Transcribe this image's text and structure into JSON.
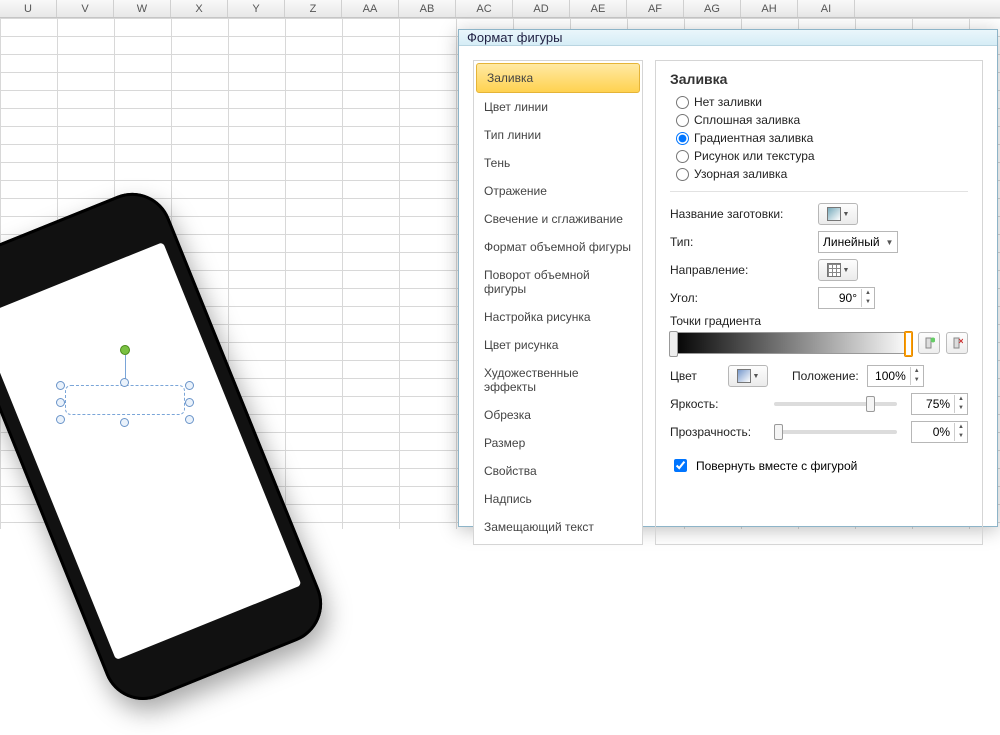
{
  "columns": [
    "U",
    "V",
    "W",
    "X",
    "Y",
    "Z",
    "AA",
    "AB",
    "AC",
    "AD",
    "AE",
    "AF",
    "AG",
    "AH",
    "AI"
  ],
  "dialog": {
    "title": "Формат фигуры",
    "nav": {
      "items": [
        "Заливка",
        "Цвет линии",
        "Тип линии",
        "Тень",
        "Отражение",
        "Свечение и сглаживание",
        "Формат объемной фигуры",
        "Поворот объемной фигуры",
        "Настройка рисунка",
        "Цвет рисунка",
        "Художественные эффекты",
        "Обрезка",
        "Размер",
        "Свойства",
        "Надпись",
        "Замещающий текст"
      ],
      "selected_index": 0
    },
    "pane": {
      "heading": "Заливка",
      "fill_options": [
        "Нет заливки",
        "Сплошная заливка",
        "Градиентная заливка",
        "Рисунок или текстура",
        "Узорная заливка"
      ],
      "fill_selected_index": 2,
      "preset_label": "Название заготовки:",
      "type_label": "Тип:",
      "type_value": "Линейный",
      "direction_label": "Направление:",
      "angle_label": "Угол:",
      "angle_value": "90°",
      "stops_label": "Точки градиента",
      "color_label": "Цвет",
      "position_label": "Положение:",
      "position_value": "100%",
      "brightness_label": "Яркость:",
      "brightness_value": "75%",
      "brightness_slider_pct": 75,
      "transparency_label": "Прозрачность:",
      "transparency_value": "0%",
      "transparency_slider_pct": 0,
      "rotate_with_shape_label": "Повернуть вместе с фигурой",
      "rotate_with_shape_checked": true
    }
  }
}
